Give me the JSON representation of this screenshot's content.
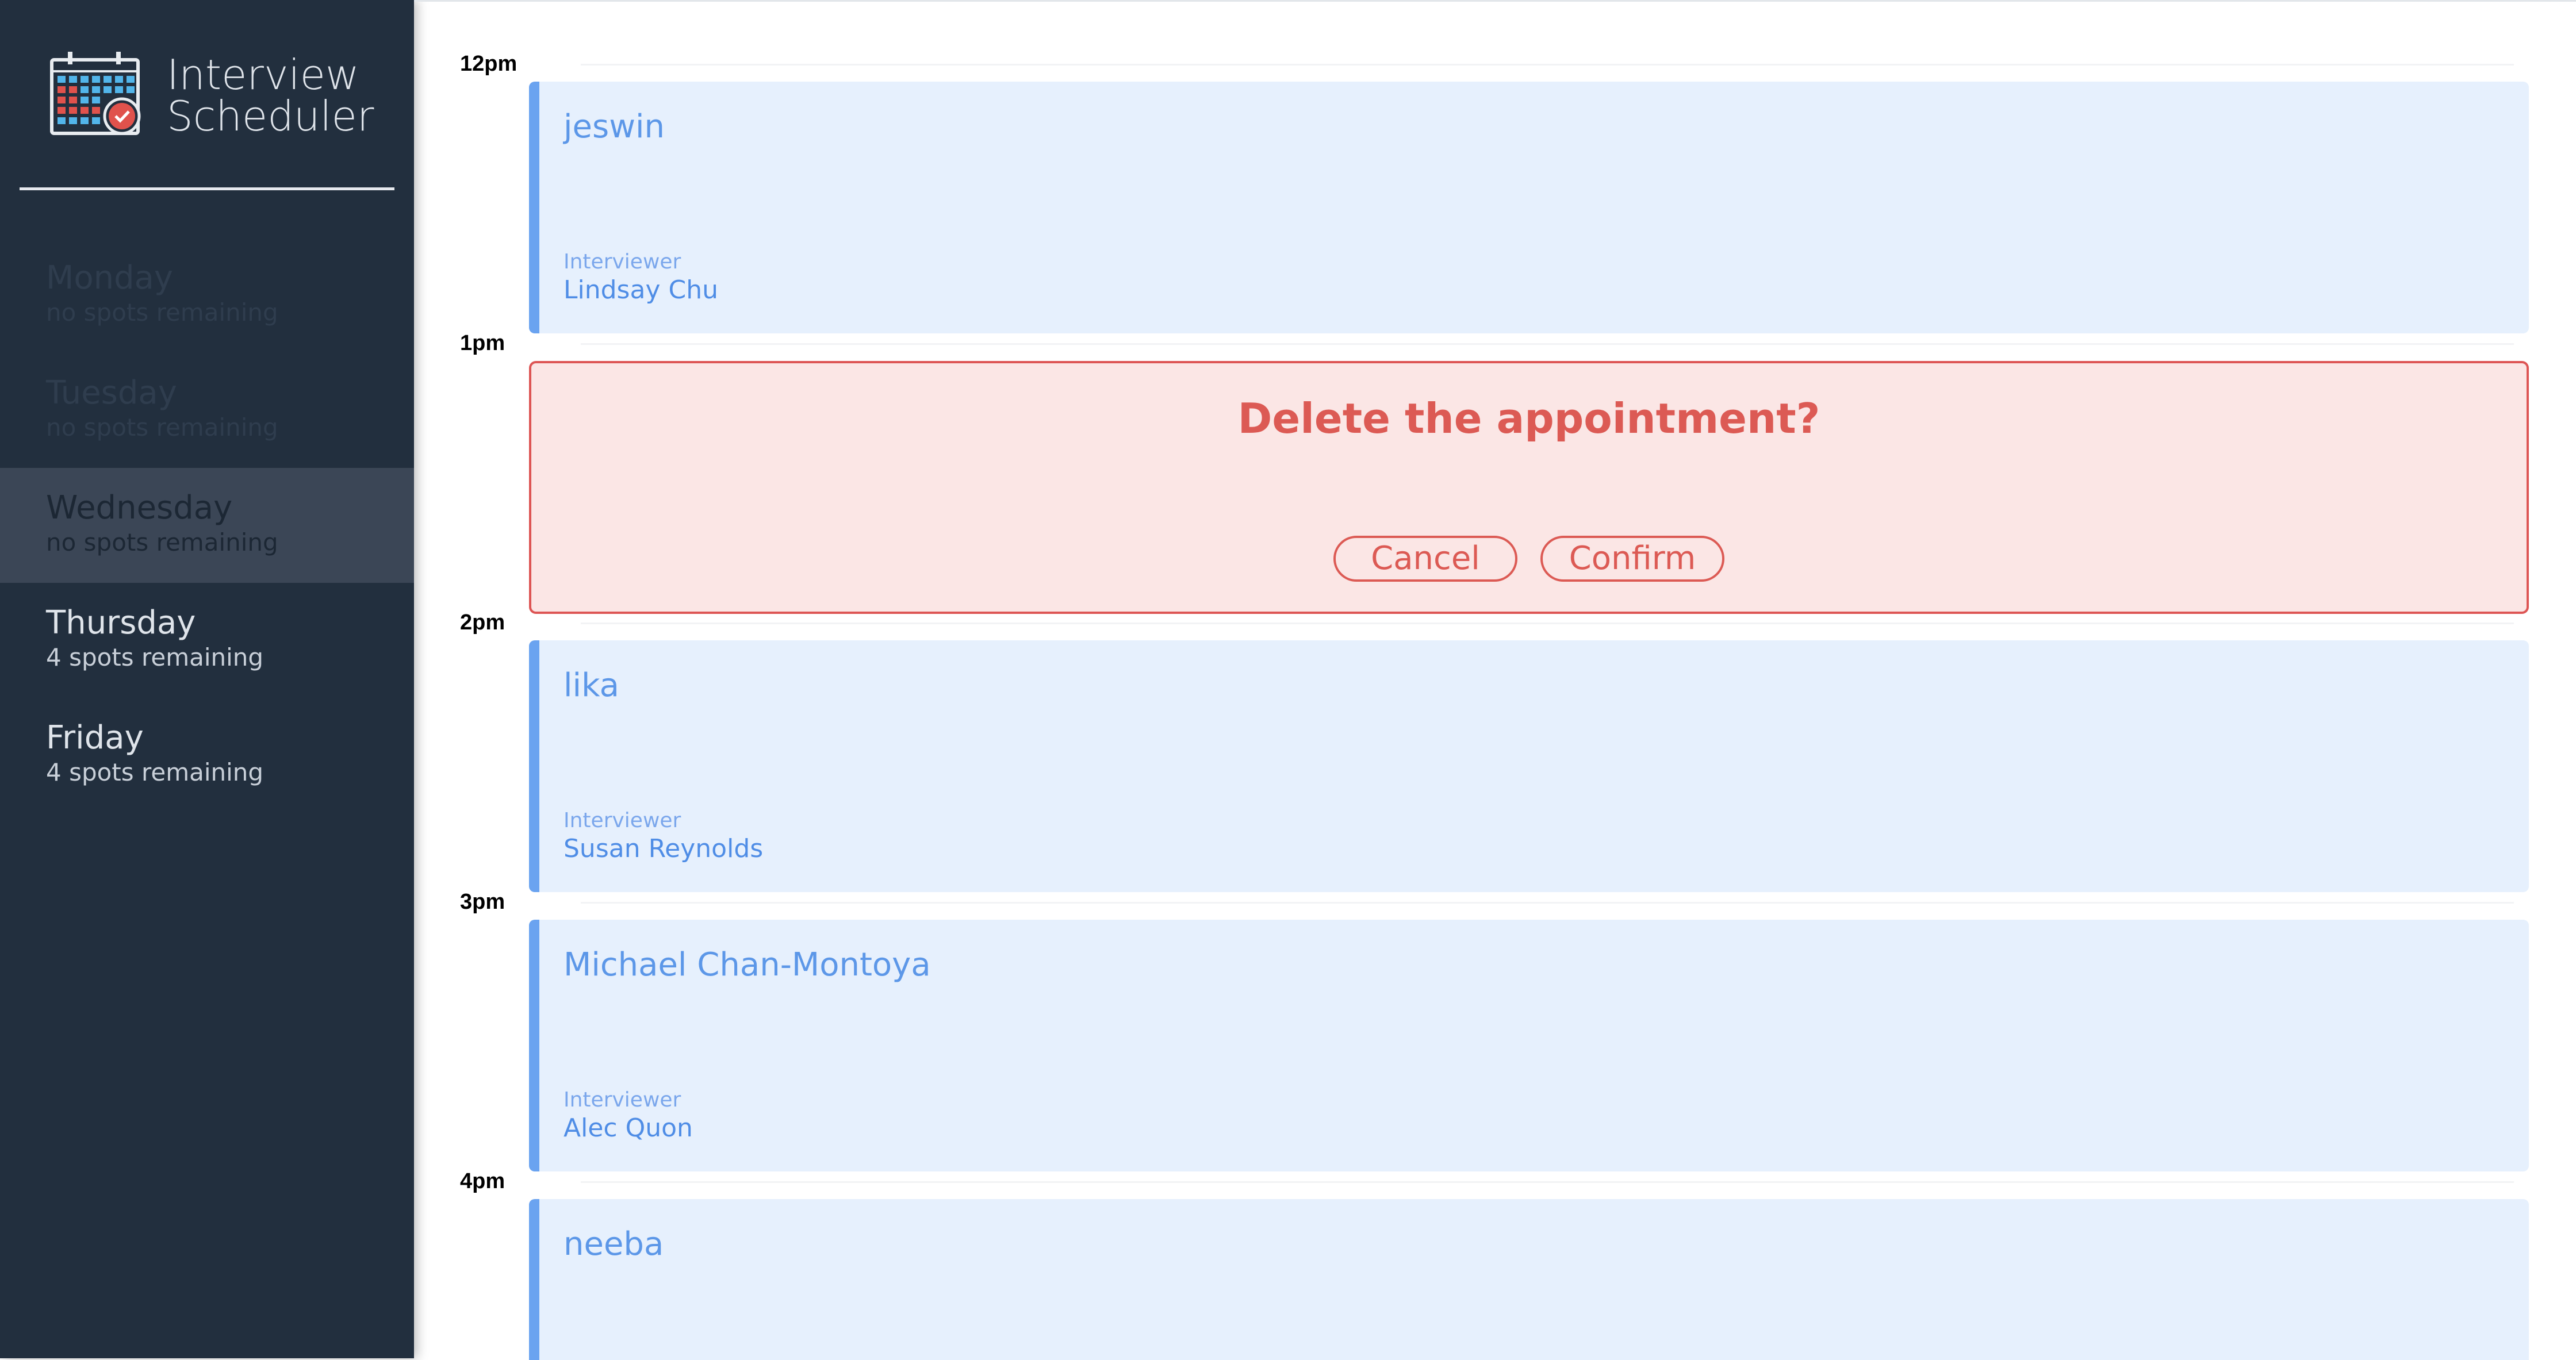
{
  "app": {
    "title_line1": "Interview",
    "title_line2": "Scheduler",
    "logo_icon": "calendar-check-icon",
    "colors": {
      "sidebar_bg": "#222f3e",
      "selected_day_bg": "#3b4656",
      "appointment_bg": "#e6f0fd",
      "appointment_accent": "#6aa3f0",
      "delete_bg": "#fbe6e5",
      "delete_accent": "#dc5a54"
    }
  },
  "days": [
    {
      "name": "Monday",
      "spots": "no spots remaining",
      "full": true,
      "selected": false
    },
    {
      "name": "Tuesday",
      "spots": "no spots remaining",
      "full": true,
      "selected": false
    },
    {
      "name": "Wednesday",
      "spots": "no spots remaining",
      "full": true,
      "selected": true
    },
    {
      "name": "Thursday",
      "spots": "4 spots remaining",
      "full": false,
      "selected": false
    },
    {
      "name": "Friday",
      "spots": "4 spots remaining",
      "full": false,
      "selected": false
    }
  ],
  "appointments": [
    {
      "time": "12pm",
      "student": "jeswin",
      "interviewer_label": "Interviewer",
      "interviewer": "Lindsay Chu"
    },
    {
      "time": "1pm",
      "mode": "confirm",
      "message": "Delete the appointment?",
      "cancel_label": "Cancel",
      "confirm_label": "Confirm"
    },
    {
      "time": "2pm",
      "student": "lika",
      "interviewer_label": "Interviewer",
      "interviewer": "Susan Reynolds"
    },
    {
      "time": "3pm",
      "student": "Michael Chan-Montoya",
      "interviewer_label": "Interviewer",
      "interviewer": "Alec Quon"
    },
    {
      "time": "4pm",
      "student": "neeba"
    }
  ]
}
